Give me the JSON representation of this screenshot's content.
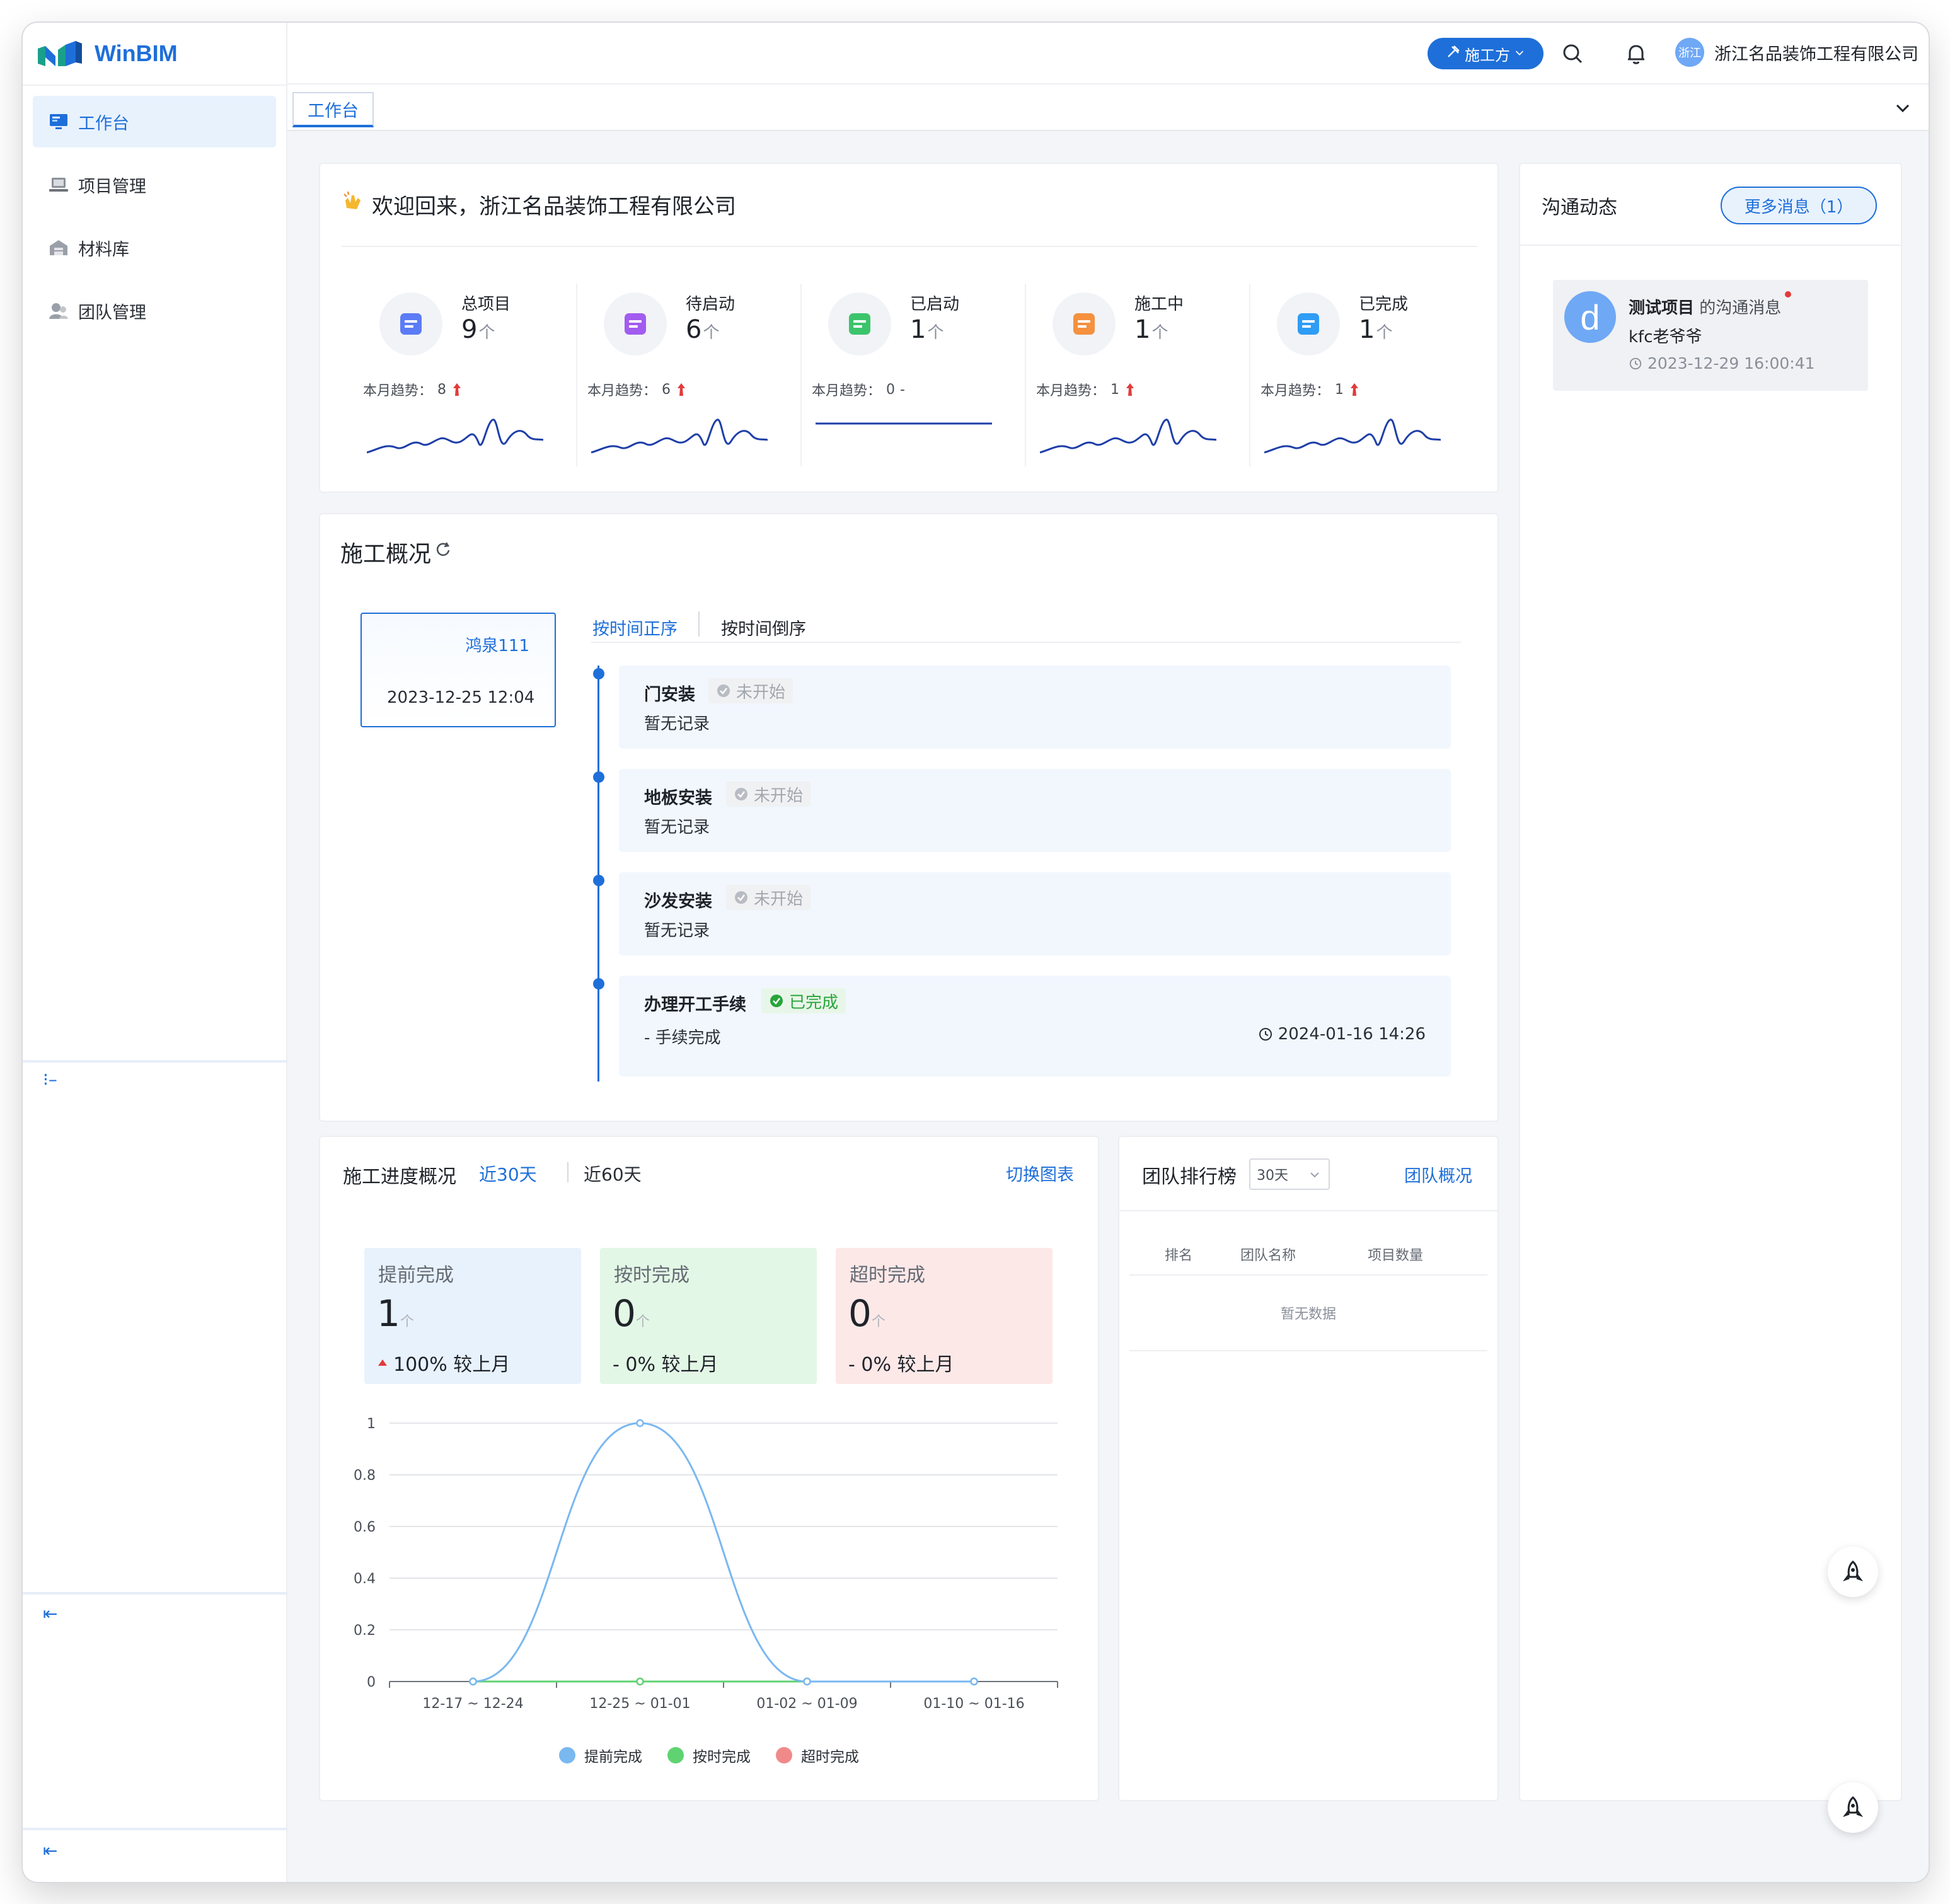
{
  "app": {
    "name": "WinBIM",
    "brand_color": "#1e6fd9"
  },
  "sidebar": {
    "items": [
      {
        "label": "工作台",
        "icon": "monitor-icon",
        "active": true
      },
      {
        "label": "项目管理",
        "icon": "laptop-icon",
        "active": false
      },
      {
        "label": "材料库",
        "icon": "warehouse-icon",
        "active": false
      },
      {
        "label": "团队管理",
        "icon": "team-icon",
        "active": false
      }
    ]
  },
  "header": {
    "role_label": "施工方",
    "company_avatar": "浙江",
    "company_name": "浙江名品装饰工程有限公司"
  },
  "tabs": [
    {
      "label": "工作台"
    }
  ],
  "welcome": {
    "title": "欢迎回来，浙江名品装饰工程有限公司",
    "trend_prefix": "本月趋势：",
    "unit": "个",
    "stats": [
      {
        "label": "总项目",
        "value": "9",
        "trend": "8",
        "trend_dir": "up",
        "color": "#5b7cf5"
      },
      {
        "label": "待启动",
        "value": "6",
        "trend": "6",
        "trend_dir": "up",
        "color": "#a25cf0"
      },
      {
        "label": "已启动",
        "value": "1",
        "trend": "0",
        "trend_dir": "flat",
        "color": "#3cc46b"
      },
      {
        "label": "施工中",
        "value": "1",
        "trend": "1",
        "trend_dir": "up",
        "color": "#f5913f"
      },
      {
        "label": "已完成",
        "value": "1",
        "trend": "1",
        "trend_dir": "up",
        "color": "#2f9cf5"
      }
    ]
  },
  "construction": {
    "title": "施工概况",
    "project": {
      "name": "鸿泉111",
      "date": "2023-12-25 12:04"
    },
    "sort_asc": "按时间正序",
    "sort_desc": "按时间倒序",
    "tasks": [
      {
        "name": "门安装",
        "status": "未开始",
        "status_type": "pending",
        "desc": "暂无记录",
        "time": ""
      },
      {
        "name": "地板安装",
        "status": "未开始",
        "status_type": "pending",
        "desc": "暂无记录",
        "time": ""
      },
      {
        "name": "沙发安装",
        "status": "未开始",
        "status_type": "pending",
        "desc": "暂无记录",
        "time": ""
      },
      {
        "name": "办理开工手续",
        "status": "已完成",
        "status_type": "done",
        "desc": "- 手续完成",
        "time": "2024-01-16 14:26"
      }
    ]
  },
  "progress": {
    "title": "施工进度概况",
    "range_30": "近30天",
    "range_60": "近60天",
    "switch_label": "切换图表",
    "kpis": [
      {
        "label": "提前完成",
        "value": "1",
        "unit": "个",
        "compare": "100% 较上月",
        "dir": "up",
        "bg": "#e8f2fd"
      },
      {
        "label": "按时完成",
        "value": "0",
        "unit": "个",
        "compare": "- 0% 较上月",
        "dir": "flat",
        "bg": "#e3f7e6"
      },
      {
        "label": "超时完成",
        "value": "0",
        "unit": "个",
        "compare": "- 0% 较上月",
        "dir": "flat",
        "bg": "#fde8e8"
      }
    ]
  },
  "chart_data": {
    "type": "line",
    "categories": [
      "12-17 ~ 12-24",
      "12-25 ~ 01-01",
      "01-02 ~ 01-09",
      "01-10 ~ 01-16"
    ],
    "series": [
      {
        "name": "提前完成",
        "values": [
          0,
          1,
          0,
          0
        ],
        "color": "#7ab8f0"
      },
      {
        "name": "按时完成",
        "values": [
          0,
          0,
          0,
          0
        ],
        "color": "#5fd372"
      },
      {
        "name": "超时完成",
        "values": [
          0,
          0,
          0,
          0
        ],
        "color": "#f08a8a"
      }
    ],
    "y_ticks": [
      "0",
      "0.2",
      "0.4",
      "0.6",
      "0.8",
      "1"
    ],
    "ylim": [
      0,
      1
    ],
    "grid": true,
    "smooth": true,
    "legend_position": "bottom-center"
  },
  "ranking": {
    "title": "团队排行榜",
    "period": "30天",
    "link": "团队概况",
    "columns": [
      "排名",
      "团队名称",
      "项目数量"
    ],
    "empty": "暂无数据"
  },
  "communication": {
    "title": "沟通动态",
    "more_button": "更多消息（1）",
    "messages": [
      {
        "avatar": "d",
        "project": "测试项目",
        "suffix": "的沟通消息",
        "sender": "kfc老爷爷",
        "time": "2023-12-29 16:00:41",
        "unread": true
      }
    ]
  }
}
